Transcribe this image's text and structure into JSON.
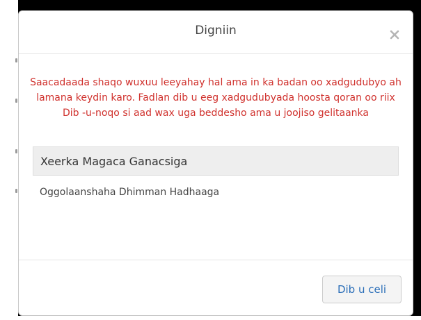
{
  "dialog": {
    "title": "Digniin",
    "close_icon": "close-icon",
    "warning_text": "Saacadaada shaqo wuxuu leeyahay hal ama in ka badan oo xadgudubyo ah lamana keydin karo. Fadlan dib u eeg xadgudubyada hoosta qoran oo riix Dib -u-noqo si aad wax uga beddesho ama u joojiso gelitaanka",
    "warning_color": "#d0312d",
    "violations": [
      {
        "label": "Xeerka Magaca Ganacsiga"
      },
      {
        "label": "Oggolaanshaha Dhimman Hadhaaga"
      }
    ],
    "back_button_label": "Dib u celi",
    "accent_color": "#2a6eb8"
  }
}
